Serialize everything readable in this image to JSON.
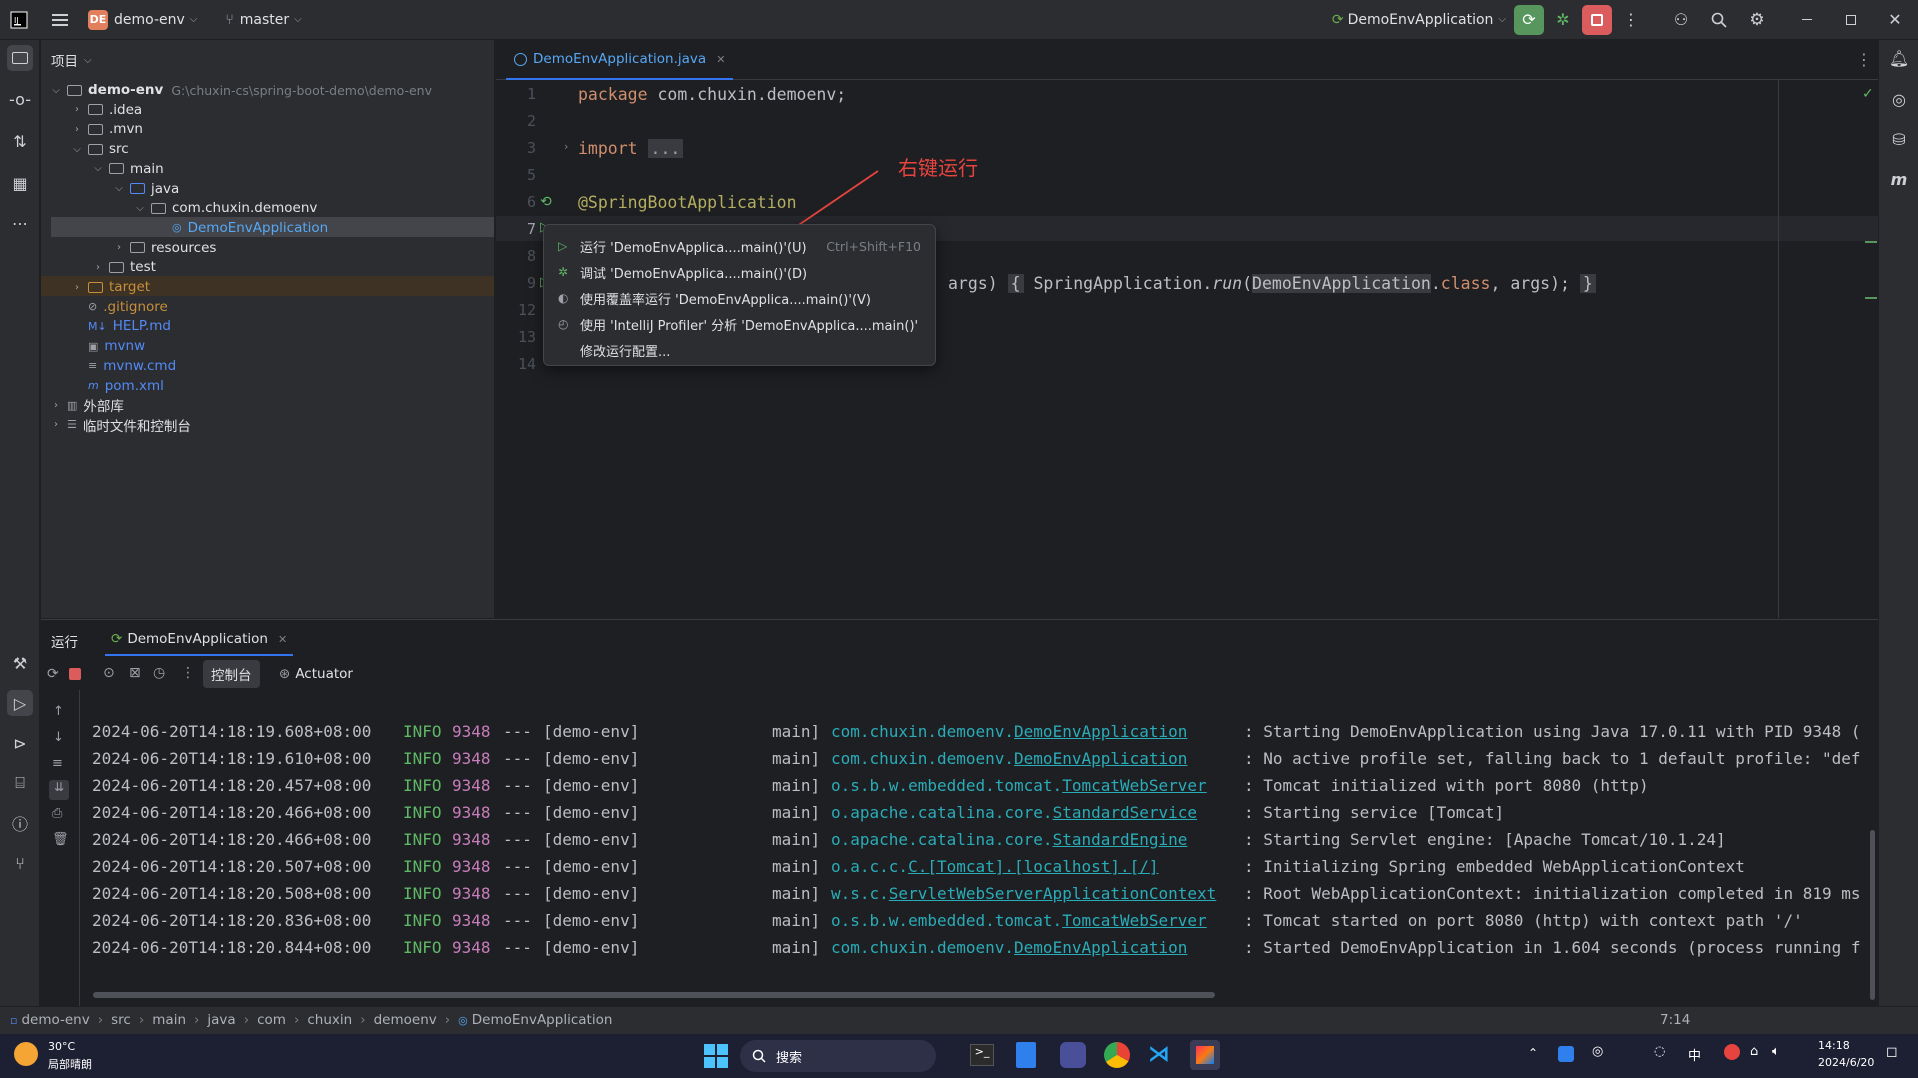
{
  "titlebar": {
    "project_badge": "DE",
    "project_name": "demo-env",
    "branch": "master",
    "run_config": "DemoEnvApplication"
  },
  "project_panel": {
    "title": "项目",
    "tree": [
      {
        "label": "demo-env",
        "path": "G:\\chuxin-cs\\spring-boot-demo\\demo-env",
        "depth": 0,
        "chevron": "down",
        "type": "module"
      },
      {
        "label": ".idea",
        "depth": 1,
        "chevron": "right",
        "type": "folder"
      },
      {
        "label": ".mvn",
        "depth": 1,
        "chevron": "right",
        "type": "folder"
      },
      {
        "label": "src",
        "depth": 1,
        "chevron": "down",
        "type": "folder"
      },
      {
        "label": "main",
        "depth": 2,
        "chevron": "down",
        "type": "folder"
      },
      {
        "label": "java",
        "depth": 3,
        "chevron": "down",
        "type": "folder-blue"
      },
      {
        "label": "com.chuxin.demoenv",
        "depth": 4,
        "chevron": "down",
        "type": "package"
      },
      {
        "label": "DemoEnvApplication",
        "depth": 5,
        "chevron": "",
        "type": "class",
        "selected": true
      },
      {
        "label": "resources",
        "depth": 3,
        "chevron": "right",
        "type": "folder"
      },
      {
        "label": "test",
        "depth": 2,
        "chevron": "right",
        "type": "folder"
      },
      {
        "label": "target",
        "depth": 1,
        "chevron": "right",
        "type": "folder-orange",
        "highlight": true
      },
      {
        "label": ".gitignore",
        "depth": 1,
        "chevron": "",
        "type": "ignore"
      },
      {
        "label": "HELP.md",
        "depth": 1,
        "chevron": "",
        "type": "md"
      },
      {
        "label": "mvnw",
        "depth": 1,
        "chevron": "",
        "type": "script"
      },
      {
        "label": "mvnw.cmd",
        "depth": 1,
        "chevron": "",
        "type": "text"
      },
      {
        "label": "pom.xml",
        "depth": 1,
        "chevron": "",
        "type": "maven"
      },
      {
        "label": "外部库",
        "depth": 0,
        "chevron": "right",
        "type": "library"
      },
      {
        "label": "临时文件和控制台",
        "depth": 0,
        "chevron": "right",
        "type": "scratch"
      }
    ]
  },
  "editor": {
    "tab_label": "DemoEnvApplication.java",
    "line_numbers": [
      "1",
      "2",
      "3",
      "5",
      "6",
      "7",
      "8",
      "9",
      "12",
      "13",
      "14"
    ],
    "line1_kw": "package",
    "line1_rest": " com.chuxin.demoenv;",
    "line3_kw": "import",
    "line3_fold": "...",
    "line6_ann": "@SpringBootApplication",
    "line9_args": "args)",
    "line9_brace_open": "{",
    "line9_call": "SpringApplication.",
    "line9_method": "run",
    "line9_paren": "(",
    "line9_class": "DemoEnvApplication",
    "line9_dot": ".",
    "line9_kw": "class",
    "line9_end": ", args);",
    "line9_brace_close": "}",
    "annotation_note": "右键运行"
  },
  "context_menu": {
    "items": [
      {
        "label": "运行 'DemoEnvApplica....main()'(U)",
        "shortcut": "Ctrl+Shift+F10",
        "icon": "run-icon"
      },
      {
        "label": "调试 'DemoEnvApplica....main()'(D)",
        "shortcut": "",
        "icon": "debug-icon"
      },
      {
        "label": "使用覆盖率运行 'DemoEnvApplica....main()'(V)",
        "shortcut": "",
        "icon": "coverage-icon"
      },
      {
        "label": "使用 'IntelliJ Profiler' 分析  'DemoEnvApplica....main()'",
        "shortcut": "",
        "icon": "profiler-icon"
      },
      {
        "label": "修改运行配置...",
        "shortcut": "",
        "icon": ""
      }
    ]
  },
  "run_panel": {
    "title": "运行",
    "tab_label": "DemoEnvApplication",
    "console_tab": "控制台",
    "actuator_tab": "Actuator",
    "logs": [
      {
        "ts": "2024-06-20T14:18:19.608+08:00",
        "level": "INFO",
        "pid": "9348",
        "sep": "---",
        "app": "[demo-env]",
        "thread": "main]",
        "logger_pkg": "com.chuxin.demoenv.",
        "logger_cls": "DemoEnvApplication",
        "msg": ": Starting DemoEnvApplication using Java 17.0.11 with PID 9348 ("
      },
      {
        "ts": "2024-06-20T14:18:19.610+08:00",
        "level": "INFO",
        "pid": "9348",
        "sep": "---",
        "app": "[demo-env]",
        "thread": "main]",
        "logger_pkg": "com.chuxin.demoenv.",
        "logger_cls": "DemoEnvApplication",
        "msg": ": No active profile set, falling back to 1 default profile: \"def"
      },
      {
        "ts": "2024-06-20T14:18:20.457+08:00",
        "level": "INFO",
        "pid": "9348",
        "sep": "---",
        "app": "[demo-env]",
        "thread": "main]",
        "logger_pkg": "o.s.b.w.embedded.tomcat.",
        "logger_cls": "TomcatWebServer",
        "msg": ": Tomcat initialized with port 8080 (http)"
      },
      {
        "ts": "2024-06-20T14:18:20.466+08:00",
        "level": "INFO",
        "pid": "9348",
        "sep": "---",
        "app": "[demo-env]",
        "thread": "main]",
        "logger_pkg": "o.apache.catalina.core.",
        "logger_cls": "StandardService",
        "msg": ": Starting service [Tomcat]"
      },
      {
        "ts": "2024-06-20T14:18:20.466+08:00",
        "level": "INFO",
        "pid": "9348",
        "sep": "---",
        "app": "[demo-env]",
        "thread": "main]",
        "logger_pkg": "o.apache.catalina.core.",
        "logger_cls": "StandardEngine",
        "msg": ": Starting Servlet engine: [Apache Tomcat/10.1.24]"
      },
      {
        "ts": "2024-06-20T14:18:20.507+08:00",
        "level": "INFO",
        "pid": "9348",
        "sep": "---",
        "app": "[demo-env]",
        "thread": "main]",
        "logger_pkg": "o.a.c.c.",
        "logger_cls": "C.[Tomcat].[localhost].[/]",
        "msg": ": Initializing Spring embedded WebApplicationContext"
      },
      {
        "ts": "2024-06-20T14:18:20.508+08:00",
        "level": "INFO",
        "pid": "9348",
        "sep": "---",
        "app": "[demo-env]",
        "thread": "main]",
        "logger_pkg": "w.s.c.",
        "logger_cls": "ServletWebServerApplicationContext",
        "msg": ": Root WebApplicationContext: initialization completed in 819 ms"
      },
      {
        "ts": "2024-06-20T14:18:20.836+08:00",
        "level": "INFO",
        "pid": "9348",
        "sep": "---",
        "app": "[demo-env]",
        "thread": "main]",
        "logger_pkg": "o.s.b.w.embedded.tomcat.",
        "logger_cls": "TomcatWebServer",
        "msg": ": Tomcat started on port 8080 (http) with context path '/'"
      },
      {
        "ts": "2024-06-20T14:18:20.844+08:00",
        "level": "INFO",
        "pid": "9348",
        "sep": "---",
        "app": "[demo-env]",
        "thread": "main]",
        "logger_pkg": "com.chuxin.demoenv.",
        "logger_cls": "DemoEnvApplication",
        "msg": ": Started DemoEnvApplication in 1.604 seconds (process running f"
      }
    ]
  },
  "statusbar": {
    "breadcrumb": [
      "demo-env",
      "src",
      "main",
      "java",
      "com",
      "chuxin",
      "demoenv",
      "DemoEnvApplication"
    ],
    "position": "7:14"
  },
  "taskbar": {
    "weather_temp": "30°C",
    "weather_desc": "局部晴朗",
    "search_label": "搜索",
    "ime": "中",
    "time": "14:18",
    "date": "2024/6/20"
  },
  "colors": {
    "accent_green": "#57965c",
    "stop_red": "#db5c5c",
    "annotation_red": "#e8443f",
    "log_teal": "#2aacb8",
    "link_teal": "#56a8f5"
  }
}
